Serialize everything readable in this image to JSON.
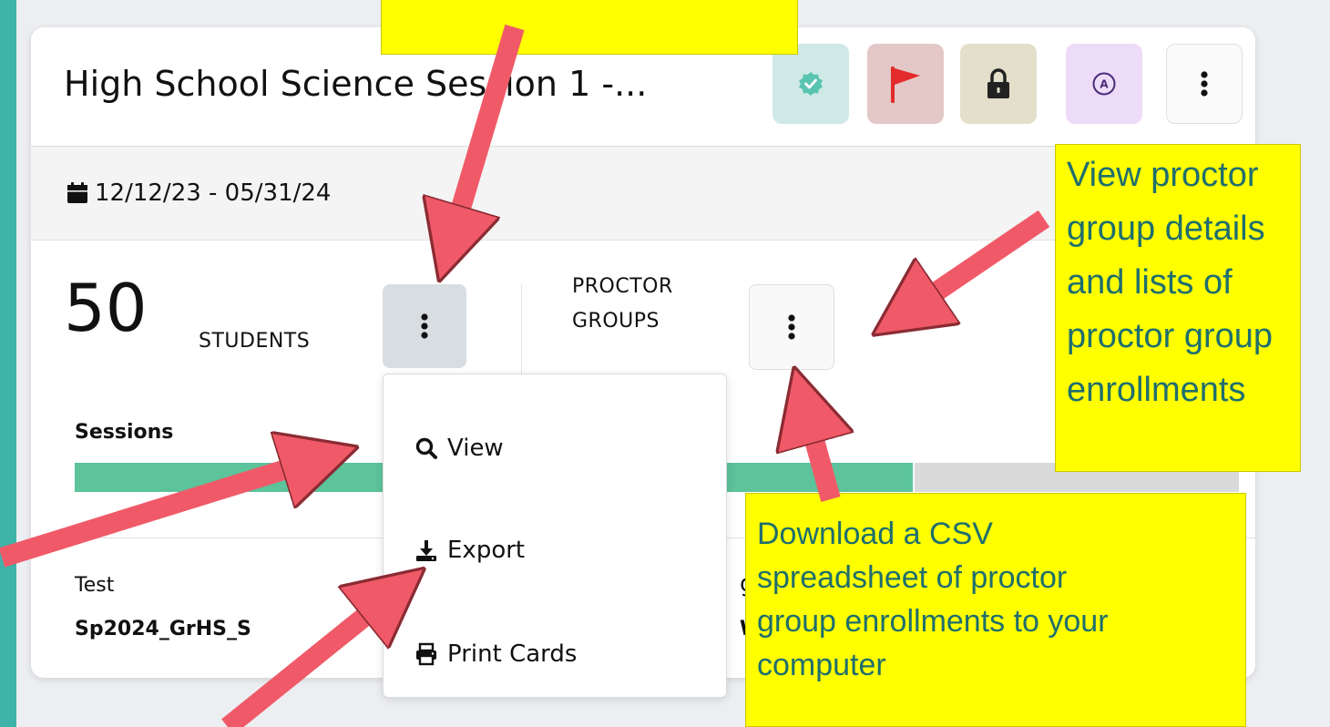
{
  "card": {
    "title": "High School Science Session 1 -...",
    "date_range": "12/12/23 - 05/31/24",
    "students": {
      "count": "50",
      "label": "STUDENTS"
    },
    "proctor_groups": {
      "label_line1": "PROCTOR",
      "label_line2": "GROUPS"
    },
    "sessions_label": "Sessions",
    "sessions_progress_fraction": 0.72,
    "test_label": "Test",
    "test_name": "Sp2024_GrHS_S",
    "partial_text_1": "g",
    "partial_text_2": "W",
    "header_icons": [
      "check-badge-icon",
      "red-flag-icon",
      "padlock-icon",
      "accommodation-a-icon",
      "kebab-menu-icon"
    ]
  },
  "dropdown": {
    "items": [
      {
        "label": "View",
        "icon": "search-icon"
      },
      {
        "label": "Export",
        "icon": "download-icon"
      },
      {
        "label": "Print Cards",
        "icon": "print-icon"
      }
    ]
  },
  "callouts": {
    "right": [
      "View proctor",
      "group details",
      "and lists of",
      "proctor group",
      "enrollments"
    ],
    "bottom": [
      "Download a CSV",
      "spreadsheet of proctor",
      "group enrollments to your",
      "computer"
    ]
  },
  "colors": {
    "accent_teal": "#3fb3a8",
    "progress_green": "#5cc39b",
    "callout_yellow": "#ffff00",
    "callout_text": "#1f6e6e",
    "arrow_red": "#f05a68"
  }
}
